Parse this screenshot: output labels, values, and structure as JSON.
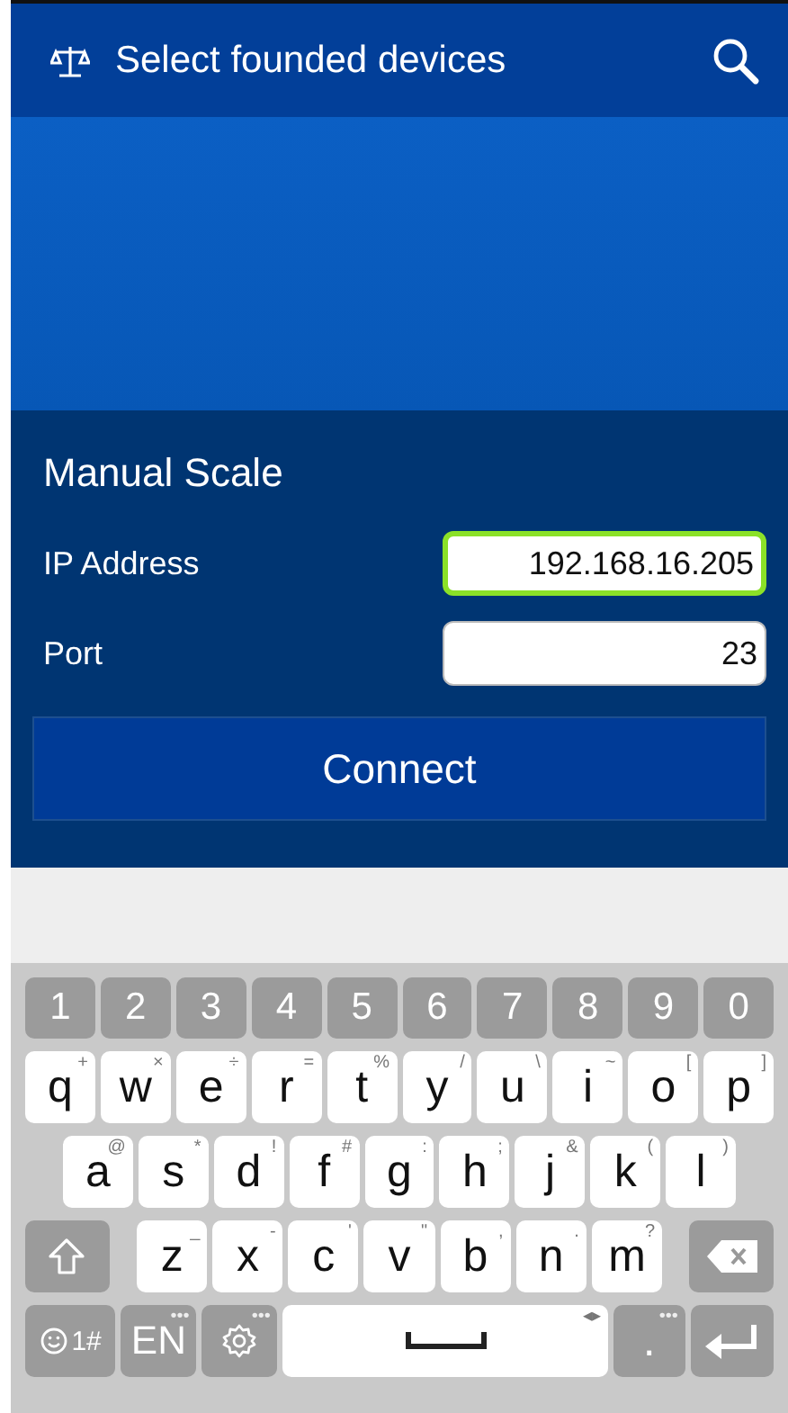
{
  "app_bar": {
    "title": "Select founded devices"
  },
  "manual": {
    "heading": "Manual Scale",
    "fields": [
      {
        "label": "IP Address",
        "value": "192.168.16.205",
        "focused": true
      },
      {
        "label": "Port",
        "value": "23",
        "focused": false
      }
    ],
    "button": "Connect"
  },
  "keyboard": {
    "number_row": [
      {
        "kind": "digit",
        "text": "1"
      },
      {
        "kind": "digit",
        "text": "2"
      },
      {
        "kind": "digit",
        "text": "3"
      },
      {
        "kind": "digit",
        "text": "4"
      },
      {
        "kind": "digit",
        "text": "5"
      },
      {
        "kind": "digit",
        "text": "6"
      },
      {
        "kind": "digit",
        "text": "7"
      },
      {
        "kind": "digit",
        "text": "8"
      },
      {
        "kind": "digit",
        "text": "9"
      },
      {
        "kind": "digit",
        "text": "0"
      }
    ],
    "top_letter_row": [
      {
        "kind": "char",
        "text": "q",
        "hint": "+"
      },
      {
        "kind": "char",
        "text": "w",
        "hint": "×"
      },
      {
        "kind": "char",
        "text": "e",
        "hint": "÷"
      },
      {
        "kind": "char",
        "text": "r",
        "hint": "="
      },
      {
        "kind": "char",
        "text": "t",
        "hint": "%"
      },
      {
        "kind": "char",
        "text": "y",
        "hint": "/"
      },
      {
        "kind": "char",
        "text": "u",
        "hint": "\\"
      },
      {
        "kind": "char",
        "text": "i",
        "hint": "~"
      },
      {
        "kind": "char",
        "text": "o",
        "hint": "["
      },
      {
        "kind": "char",
        "text": "p",
        "hint": "]"
      }
    ],
    "middle_letter_row": [
      {
        "kind": "char",
        "text": "a",
        "hint": "@"
      },
      {
        "kind": "char",
        "text": "s",
        "hint": "*"
      },
      {
        "kind": "char",
        "text": "d",
        "hint": "!"
      },
      {
        "kind": "char",
        "text": "f",
        "hint": "#"
      },
      {
        "kind": "char",
        "text": "g",
        "hint": ":"
      },
      {
        "kind": "char",
        "text": "h",
        "hint": ";"
      },
      {
        "kind": "char",
        "text": "j",
        "hint": "&"
      },
      {
        "kind": "char",
        "text": "k",
        "hint": "("
      },
      {
        "kind": "char",
        "text": "l",
        "hint": ")"
      }
    ],
    "bottom_letter_row": [
      {
        "kind": "shift"
      },
      {
        "kind": "char",
        "text": "z",
        "hint": "_"
      },
      {
        "kind": "char",
        "text": "x",
        "hint": "-"
      },
      {
        "kind": "char",
        "text": "c",
        "hint": "'"
      },
      {
        "kind": "char",
        "text": "v",
        "hint": "\""
      },
      {
        "kind": "char",
        "text": "b",
        "hint": ","
      },
      {
        "kind": "char",
        "text": "n",
        "hint": "."
      },
      {
        "kind": "char",
        "text": "m",
        "hint": "?"
      },
      {
        "kind": "backspace"
      }
    ],
    "function_row": [
      {
        "kind": "symbols",
        "text": "1#"
      },
      {
        "kind": "lang",
        "text": "EN",
        "hint": "•••"
      },
      {
        "kind": "settings",
        "hint": "•••"
      },
      {
        "kind": "space",
        "hint": "◂▸"
      },
      {
        "kind": "period",
        "text": ".",
        "hint": "•••"
      },
      {
        "kind": "enter"
      }
    ]
  }
}
